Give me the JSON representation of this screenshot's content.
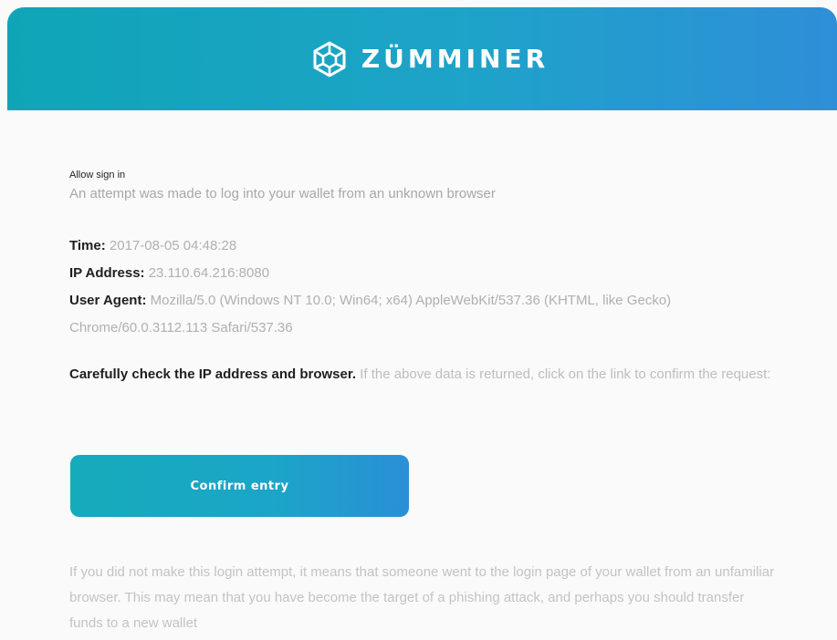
{
  "header": {
    "brand_name": "ZÜMMINER",
    "logo_icon": "hexagon-logo-icon",
    "colors": {
      "gradient_start": "#0fa5b6",
      "gradient_end": "#2e8fd8"
    }
  },
  "message": {
    "title": "Allow sign in",
    "lead": "An attempt was made to log into your wallet from an unknown browser",
    "time_label": "Time:",
    "time_value": "2017-08-05 04:48:28",
    "ip_label": "IP Address:",
    "ip_value": "23.110.64.216:8080",
    "ua_label": "User Agent:",
    "ua_value": "Mozilla/5.0 (Windows NT 10.0; Win64; x64) AppleWebKit/537.36 (KHTML, like Gecko) Chrome/60.0.3112.113 Safari/537.36",
    "warning_bold": "Carefully check the IP address and browser.",
    "warning_rest": "If the above data is returned, click on the link to confirm the request:",
    "confirm_button": "Confirm entry",
    "footer": "If you did not make this login attempt, it means that someone went to the login page of your wallet from an unfamiliar browser. This may mean that you have become the target of a phishing attack, and perhaps you should transfer funds to a new wallet"
  }
}
